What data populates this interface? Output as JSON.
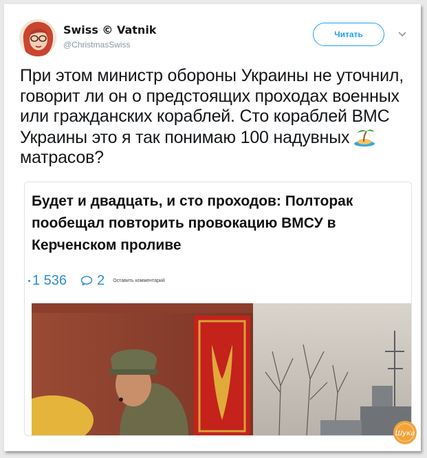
{
  "tweet": {
    "author_name": "Swiss © Vatnik",
    "author_handle": "@ChristmasSwiss",
    "follow_label": "Читать",
    "text_before_emoji": "При этом министр обороны Украины не уточнил, говорит ли он о предстоящих проходах военных или гражданских кораблей. Сто кораблей ВМС Украины это я так понимаю 100 надувных",
    "text_after_emoji": "матрасов?",
    "emoji_icon": "desert-island-icon"
  },
  "card": {
    "title": "Будет и двадцать, и сто проходов: Полторак пообещал повторить провокацию ВМСУ в Керченском проливе",
    "views": "1 536",
    "comments": "2",
    "leave_comment_label": "Оставить комментарий",
    "image_icon": "news-photo"
  },
  "colors": {
    "accent": "#1da1f2",
    "stats": "#2f8dcc",
    "text": "#14171a",
    "muted": "#8899a6"
  },
  "watermark": {
    "icon": "watermark-badge-icon",
    "text": "Шука"
  }
}
